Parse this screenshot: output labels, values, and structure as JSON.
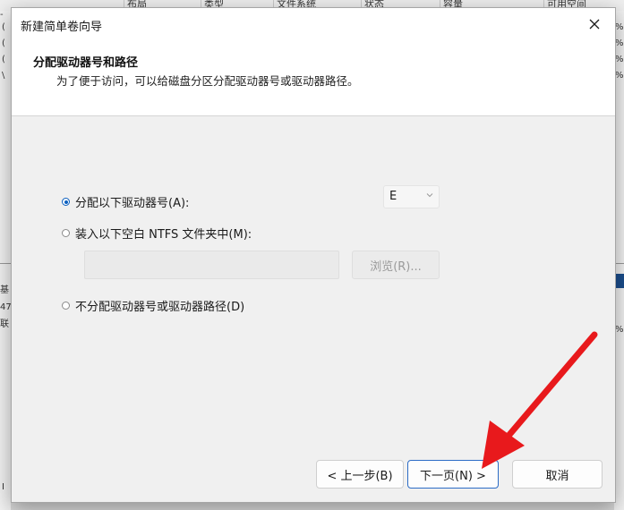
{
  "background": {
    "columns": [
      "布局",
      "类型",
      "文件系统",
      "状态",
      "容量",
      "可用空间"
    ],
    "left_glyphs": [
      "-",
      "(",
      "(",
      "(",
      "\\",
      "基",
      "47",
      "联",
      "I"
    ],
    "right_glyphs": [
      "%",
      "%",
      "%",
      "%",
      "%"
    ]
  },
  "dialog": {
    "title": "新建简单卷向导",
    "header_title": "分配驱动器号和路径",
    "header_subtitle": "为了便于访问，可以给磁盘分区分配驱动器号或驱动器路径。",
    "options": {
      "assign_letter": "分配以下驱动器号(A):",
      "mount_folder": "装入以下空白 NTFS 文件夹中(M):",
      "no_assign": "不分配驱动器号或驱动器路径(D)"
    },
    "selected_option": "assign_letter",
    "drive_letter": "E",
    "folder_path": "",
    "browse_label": "浏览(R)...",
    "buttons": {
      "back": "< 上一步(B)",
      "next": "下一页(N) >",
      "cancel": "取消"
    }
  },
  "colors": {
    "accent": "#0a5fbf",
    "annotation_arrow": "#e8191c"
  }
}
